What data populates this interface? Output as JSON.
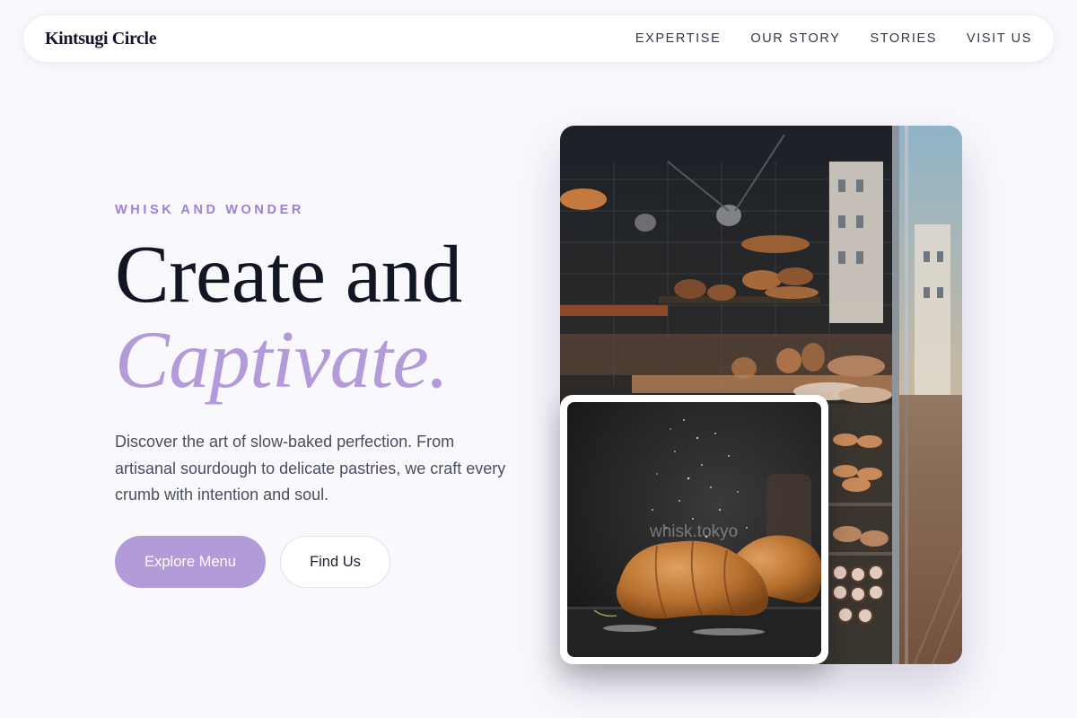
{
  "brand": {
    "name": "Kintsugi Circle"
  },
  "nav": {
    "links": [
      "EXPERTISE",
      "OUR STORY",
      "STORIES",
      "VISIT US"
    ]
  },
  "hero": {
    "eyebrow": "WHISK AND WONDER",
    "title_line1": "Create and",
    "title_line2": "Captivate.",
    "lead": "Discover the art of slow-baked perfection. From artisanal sourdough to delicate pastries, we craft every crumb with intention and soul.",
    "primary_cta": "Explore Menu",
    "secondary_cta": "Find Us"
  },
  "images": {
    "main_alt": "Bakery shop window with bread shelves and street reflection",
    "inset_alt": "Croissants dusted with powdered sugar on dark slate",
    "inset_watermark": "whisk.tokyo"
  },
  "colors": {
    "accent": "#b39ad9",
    "eyebrow": "#a07fd4",
    "background": "#f9f8fd",
    "heading": "#121624"
  }
}
